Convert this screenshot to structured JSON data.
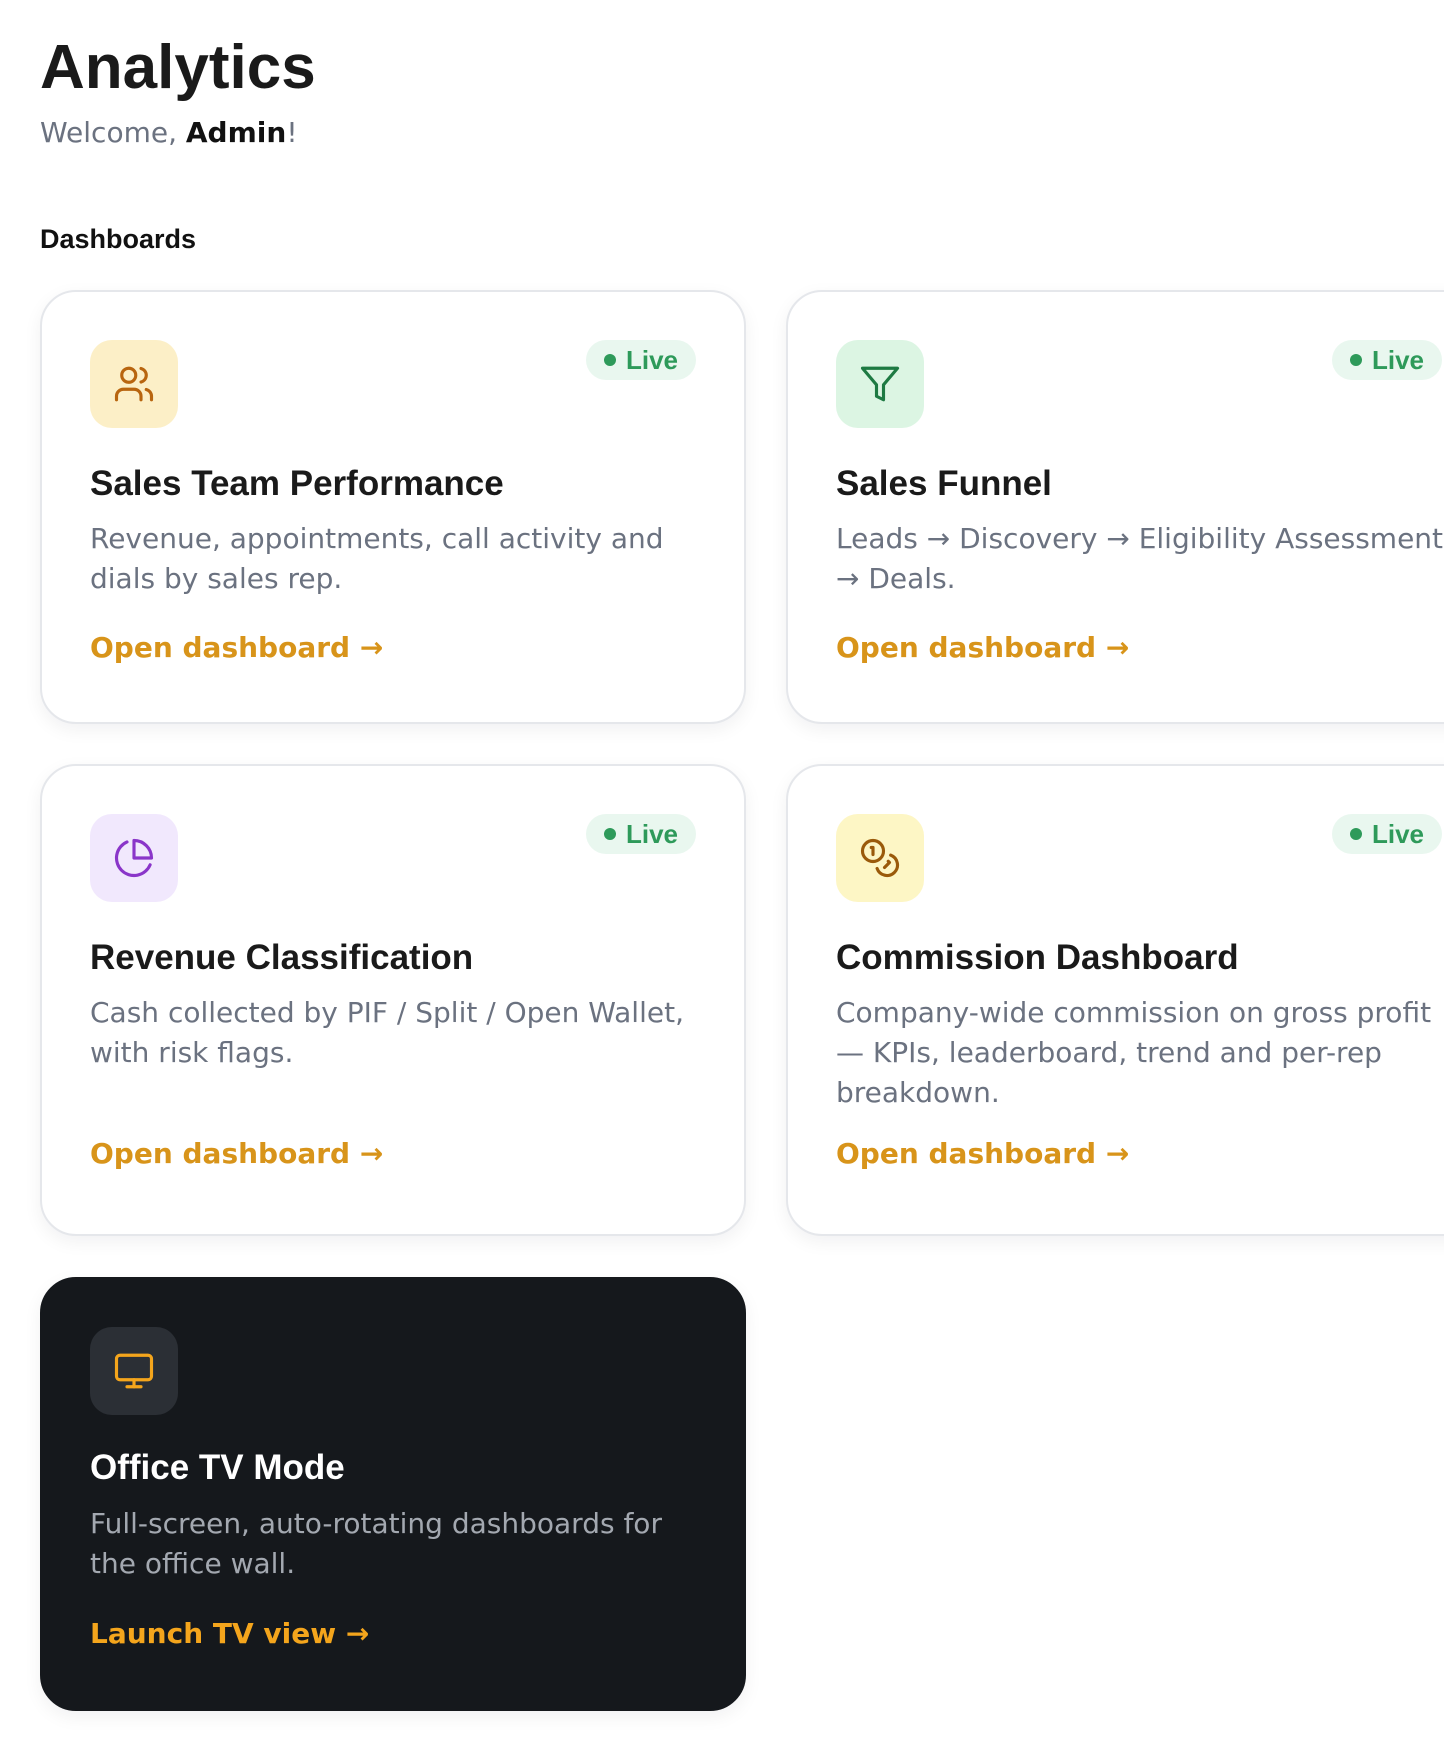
{
  "header": {
    "title": "Analytics",
    "welcome_prefix": "Welcome, ",
    "user_name": "Admin",
    "welcome_suffix": "!"
  },
  "section": {
    "title": "Dashboards"
  },
  "cards": [
    {
      "icon": "users-icon",
      "icon_bg": "#fcefc7",
      "icon_color": "#b8650f",
      "badge": "Live",
      "title": "Sales Team Performance",
      "description": "Revenue, appointments, call activity and dials by sales rep.",
      "link": "Open dashboard →"
    },
    {
      "icon": "funnel-icon",
      "icon_bg": "#dcf5e3",
      "icon_color": "#1e7a43",
      "badge": "Live",
      "title": "Sales Funnel",
      "description": "Leads → Discovery → Eligibility Assessment → Deals.",
      "link": "Open dashboard →"
    },
    {
      "icon": "pie-chart-icon",
      "icon_bg": "#f1e8fd",
      "icon_color": "#8a35c9",
      "badge": "Live",
      "title": "Revenue Classification",
      "description": "Cash collected by PIF / Split / Open Wallet, with risk flags.",
      "link": "Open dashboard →"
    },
    {
      "icon": "coins-icon",
      "icon_bg": "#fdf6c5",
      "icon_color": "#9a5a0a",
      "badge": "Live",
      "title": "Commission Dashboard",
      "description": "Company-wide commission on gross profit — KPIs, leaderboard, trend and per-rep breakdown.",
      "link": "Open dashboard →"
    }
  ],
  "tv_card": {
    "icon": "monitor-icon",
    "icon_bg": "#2b2f35",
    "icon_color": "#f4a51c",
    "title": "Office TV Mode",
    "description": "Full-screen, auto-rotating dashboards for the office wall.",
    "link": "Launch TV view →"
  },
  "colors": {
    "accent": "#d8941a",
    "live_green": "#2e9a5a",
    "live_bg": "#e9f7ef",
    "dark_card": "#15181c"
  }
}
